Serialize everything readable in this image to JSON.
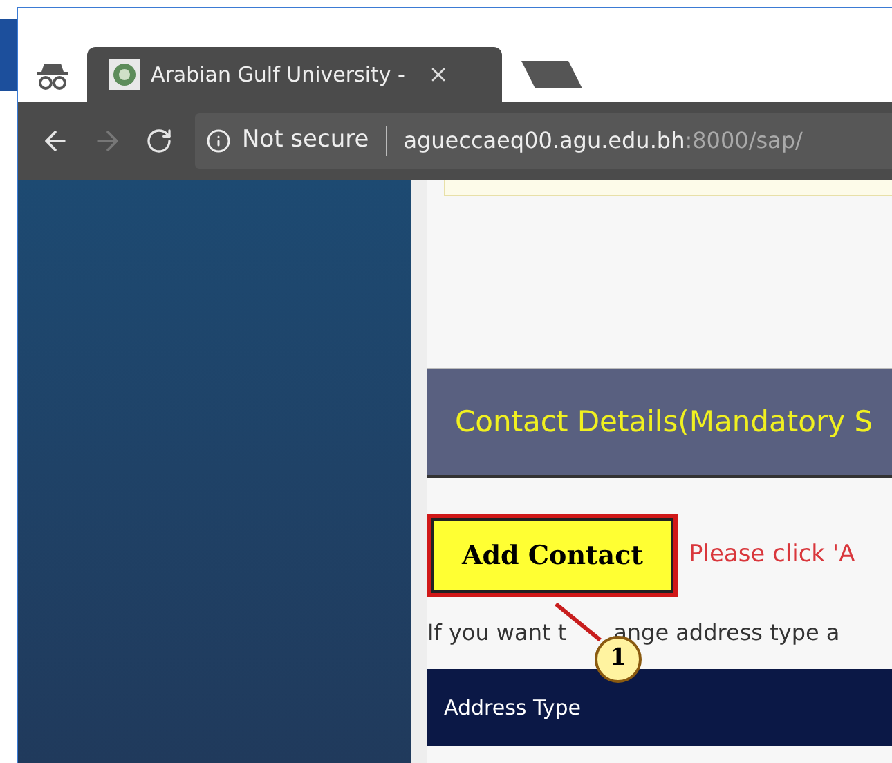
{
  "browser": {
    "tab_title": "Arabian Gulf University -",
    "security": "Not secure",
    "url_host": "agueccaeq00.agu.edu.bh",
    "url_rest": ":8000/sap/"
  },
  "section": {
    "title": "Contact Details(Mandatory S"
  },
  "add_button": {
    "label": "Add Contact"
  },
  "hint": "Please click 'A",
  "note": {
    "before": "If you want t",
    "after": "ange address type a"
  },
  "callout": {
    "number": "1"
  },
  "table": {
    "columns": [
      "Address Type"
    ]
  }
}
